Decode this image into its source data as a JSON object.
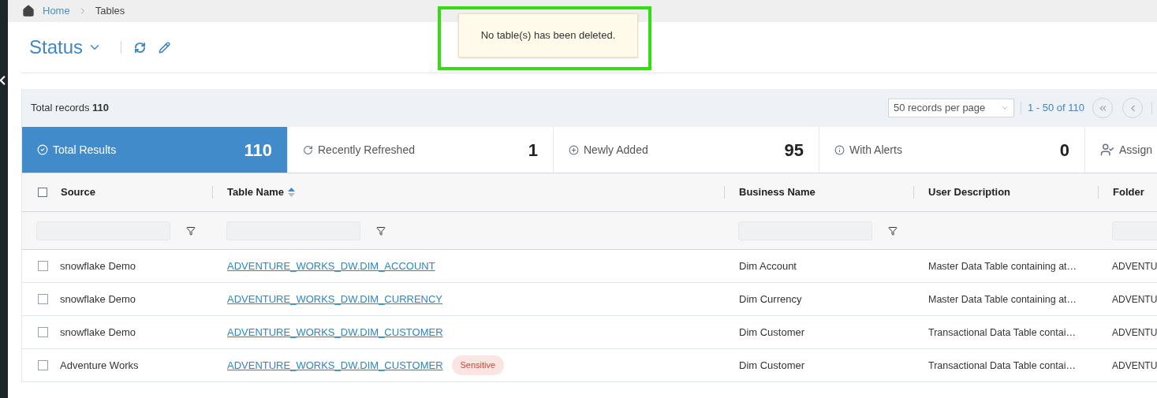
{
  "breadcrumb": [
    {
      "label": "Home",
      "kind": "link"
    },
    {
      "label": "Tables",
      "kind": "current"
    }
  ],
  "header": {
    "title": "Status"
  },
  "toast": {
    "message": "No table(s) has been deleted.",
    "highlighted": true
  },
  "toolbar": {
    "total_label": "Total records",
    "total_value": "110",
    "page_size": "50 records per page",
    "range": "1 - 50 of 110"
  },
  "tiles": [
    {
      "label": "Total Results",
      "count": "110",
      "selected": true,
      "kind": "check"
    },
    {
      "label": "Recently Refreshed",
      "count": "1",
      "selected": false,
      "kind": "refresh"
    },
    {
      "label": "Newly Added",
      "count": "95",
      "selected": false,
      "kind": "plus"
    },
    {
      "label": "With Alerts",
      "count": "0",
      "selected": false,
      "kind": "alert"
    },
    {
      "label": "Assign",
      "selected": false,
      "kind": "user"
    }
  ],
  "table": {
    "all_checked": false,
    "columns": [
      {
        "label": "Source",
        "sorted": false,
        "filter": true,
        "funnel": true
      },
      {
        "label": "Table Name",
        "sorted": true,
        "filter": true,
        "funnel": true
      },
      {
        "label": "Business Name",
        "sorted": false,
        "filter": true,
        "funnel": true
      },
      {
        "label": "User Description",
        "sorted": false,
        "filter": false,
        "funnel": false
      },
      {
        "label": "Folder",
        "sorted": false,
        "filter": true,
        "funnel": false
      }
    ],
    "rows": [
      {
        "checked": false,
        "source": "snowflake Demo",
        "table_name": "ADVENTURE_WORKS_DW.DIM_ACCOUNT",
        "business_name": "Dim Account",
        "description": "Master Data Table containing at…",
        "folder": "ADVENTU"
      },
      {
        "checked": false,
        "source": "snowflake Demo",
        "table_name": "ADVENTURE_WORKS_DW.DIM_CURRENCY",
        "business_name": "Dim Currency",
        "description": "Master Data Table containing at…",
        "folder": "ADVENTU"
      },
      {
        "checked": false,
        "source": "snowflake Demo",
        "table_name": "ADVENTURE_WORKS_DW.DIM_CUSTOMER",
        "business_name": "Dim Customer",
        "description": "Transactional Data Table contai…",
        "folder": "ADVENTU"
      },
      {
        "checked": false,
        "source": "Adventure Works",
        "table_name": "ADVENTURE_WORKS_DW.DIM_CUSTOMER",
        "badge": "Sensitive",
        "business_name": "Dim Customer",
        "description": "Transactional Data Table contai…",
        "folder": "ADVENTU"
      }
    ]
  }
}
